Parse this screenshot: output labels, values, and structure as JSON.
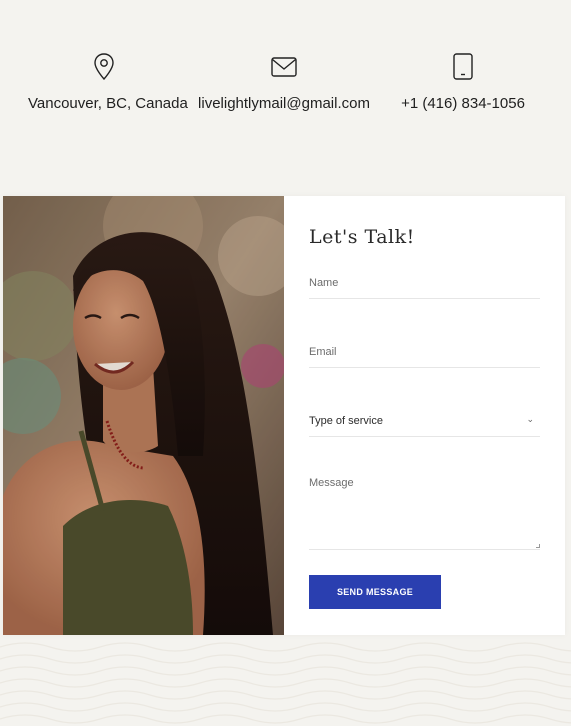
{
  "contacts": [
    {
      "icon": "map-pin-icon",
      "text": "Vancouver, BC, Canada"
    },
    {
      "icon": "envelope-icon",
      "text": "livelightlymail@gmail.com"
    },
    {
      "icon": "tablet-icon",
      "text": "+1 (416) 834-1056"
    }
  ],
  "form": {
    "title": "Let's Talk!",
    "name_placeholder": "Name",
    "email_placeholder": "Email",
    "service_selected": "Type of service",
    "message_placeholder": "Message",
    "submit_label": "SEND MESSAGE"
  },
  "colors": {
    "background": "#f4f3ef",
    "accent": "#2a3fb0",
    "card": "#ffffff"
  }
}
